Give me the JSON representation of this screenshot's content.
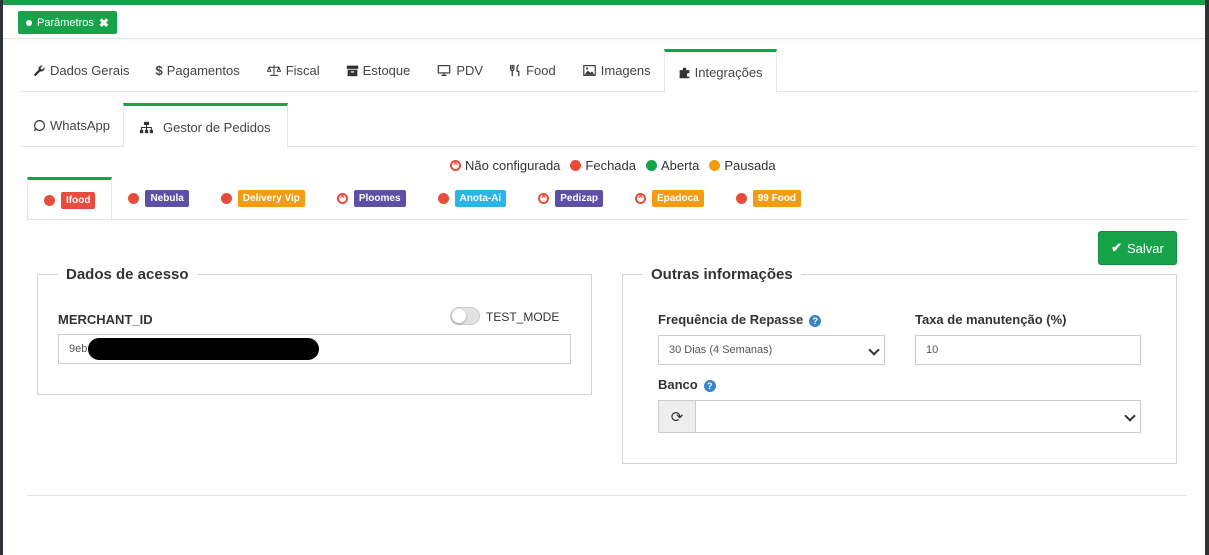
{
  "page_tab": {
    "label": "Parâmetros"
  },
  "main_tabs": [
    {
      "label": "Dados Gerais",
      "icon": "wrench-icon"
    },
    {
      "label": "Pagamentos",
      "icon": "dollar-icon"
    },
    {
      "label": "Fiscal",
      "icon": "balance-scale-icon"
    },
    {
      "label": "Estoque",
      "icon": "archive-icon"
    },
    {
      "label": "PDV",
      "icon": "desktop-icon"
    },
    {
      "label": "Food",
      "icon": "cutlery-icon"
    },
    {
      "label": "Imagens",
      "icon": "image-icon"
    },
    {
      "label": "Integrações",
      "icon": "puzzle-icon",
      "active": true
    }
  ],
  "sub_tabs": [
    {
      "label": "WhatsApp",
      "icon": "whatsapp-icon"
    },
    {
      "label": "Gestor de Pedidos",
      "icon": "sitemap-icon",
      "active": true
    }
  ],
  "legend": [
    {
      "label": "Não configurada",
      "type": "x",
      "color": "#e74c3c"
    },
    {
      "label": "Fechada",
      "type": "dot",
      "color": "#e74c3c"
    },
    {
      "label": "Aberta",
      "type": "dot",
      "color": "#16a34a"
    },
    {
      "label": "Pausada",
      "type": "dot",
      "color": "#f39c12"
    }
  ],
  "integrations": [
    {
      "label": "Ifood",
      "status": "dot",
      "status_color": "#e74c3c",
      "badge_color": "#e74c3c",
      "active": true
    },
    {
      "label": "Nebula",
      "status": "dot",
      "status_color": "#e74c3c",
      "badge_color": "#5b4fa6"
    },
    {
      "label": "Delivery Vip",
      "status": "dot",
      "status_color": "#e74c3c",
      "badge_color": "#f39c12"
    },
    {
      "label": "Ploomes",
      "status": "x",
      "status_color": "#e74c3c",
      "badge_color": "#5b4fa6"
    },
    {
      "label": "Anota-Ai",
      "status": "dot",
      "status_color": "#e74c3c",
      "badge_color": "#29b6e6"
    },
    {
      "label": "Pedizap",
      "status": "x",
      "status_color": "#e74c3c",
      "badge_color": "#5b4fa6"
    },
    {
      "label": "Epadoca",
      "status": "x",
      "status_color": "#e74c3c",
      "badge_color": "#f39c12"
    },
    {
      "label": "99 Food",
      "status": "dot",
      "status_color": "#e74c3c",
      "badge_color": "#f39c12"
    }
  ],
  "save_label": "Salvar",
  "dados_acesso": {
    "title": "Dados de acesso",
    "merchant_label": "MERCHANT_ID",
    "merchant_value": "9eb",
    "test_mode_label": "TEST_MODE",
    "test_mode_on": false
  },
  "outras": {
    "title": "Outras informações",
    "freq_label": "Frequência de Repasse",
    "freq_value": "30 Dias (4 Semanas)",
    "taxa_label": "Taxa de manutenção (%)",
    "taxa_value": "10",
    "banco_label": "Banco",
    "banco_value": ""
  }
}
